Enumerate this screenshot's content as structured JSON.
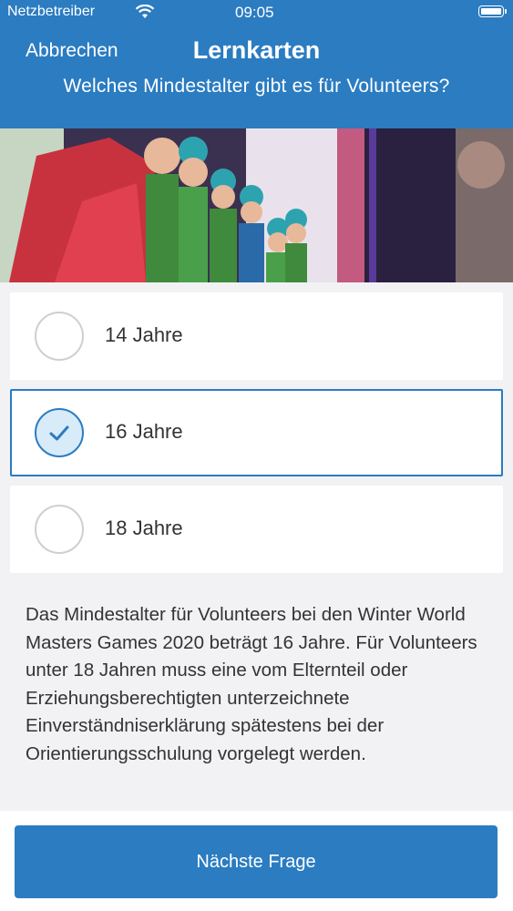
{
  "status_bar": {
    "carrier": "Netzbetreiber",
    "time": "09:05"
  },
  "nav": {
    "cancel_label": "Abbrechen",
    "title": "Lernkarten"
  },
  "question": "Welches Mindestalter gibt es für Volunteers?",
  "answers": [
    {
      "label": "14 Jahre",
      "selected": false
    },
    {
      "label": "16 Jahre",
      "selected": true
    },
    {
      "label": "18 Jahre",
      "selected": false
    }
  ],
  "explanation": "Das Mindestalter für Volunteers bei den Winter World Masters Games 2020 beträgt 16 Jahre. Für Volunteers unter 18 Jahren muss eine vom Elternteil oder Erziehungsberechtigten unterzeichnete Einverständniserklärung spätestens bei der Orientierungsschulung vorgelegt werden.",
  "next_button_label": "Nächste Frage",
  "colors": {
    "accent": "#2b7cc1",
    "background": "#f2f2f4",
    "selected_fill": "#d8ebf9"
  }
}
